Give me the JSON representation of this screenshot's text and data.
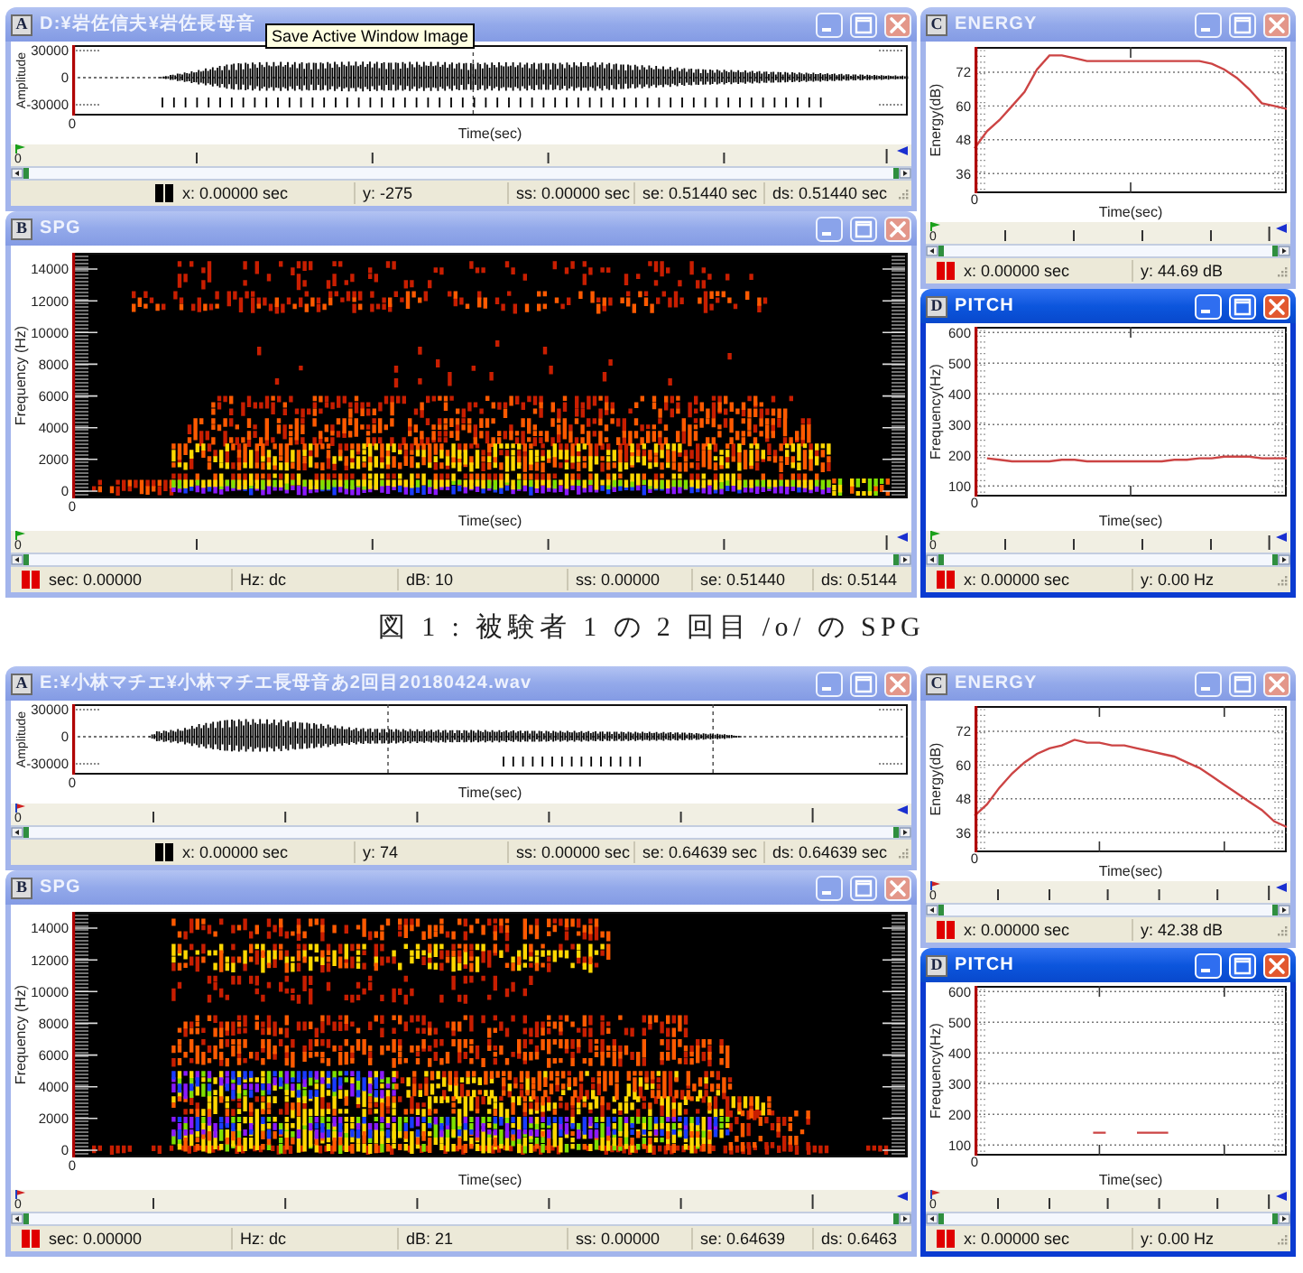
{
  "blocks": [
    {
      "kind": "screenshot",
      "windows": [
        {
          "kind": "waveform",
          "letter": "A",
          "title": "D:¥岩佐信夫¥岩佐長母音",
          "tooltip": "Save Active Window Image",
          "active": false,
          "y_label": "Amplitude",
          "y_ticks": [
            "30000",
            "0",
            "-30000"
          ],
          "x_tick": "0",
          "x_label": "Time(sec)",
          "marker_label": "0",
          "status": [
            "x: 0.00000 sec",
            "y: -275",
            "ss: 0.00000 sec",
            "se: 0.51440 sec",
            "ds: 0.51440 sec"
          ]
        },
        {
          "kind": "spectrogram",
          "letter": "B",
          "title": "SPG",
          "active": false,
          "y_label": "Frequency (Hz)",
          "y_ticks": [
            "14000",
            "12000",
            "10000",
            "8000",
            "6000",
            "4000",
            "2000",
            "0"
          ],
          "x_tick": "0",
          "x_label": "Time(sec)",
          "marker_label": "0",
          "status": [
            "sec: 0.00000",
            "Hz: dc",
            "dB: 10",
            "ss: 0.00000",
            "se: 0.51440",
            "ds: 0.5144"
          ]
        },
        {
          "kind": "energy",
          "letter": "C",
          "title": "ENERGY",
          "active": false,
          "chart_data": {
            "type": "line",
            "xlabel": "Time(sec)",
            "ylabel": "Energy(dB)",
            "series": [
              {
                "color": "#cc4444",
                "values": [
                  45,
                  51,
                  55,
                  60,
                  65,
                  73,
                  78,
                  78,
                  77,
                  76,
                  76,
                  76,
                  76,
                  76,
                  76,
                  76,
                  76,
                  76,
                  76,
                  75,
                  73,
                  70,
                  66,
                  61,
                  60,
                  59
                ]
              }
            ],
            "ylim": [
              29,
              81
            ],
            "yticks": [
              72,
              60,
              48,
              36
            ],
            "grid": true,
            "annotations": [
              "0"
            ]
          },
          "marker_label": "0",
          "status": [
            "x: 0.00000 sec",
            "y: 44.69 dB"
          ]
        },
        {
          "kind": "pitch",
          "letter": "D",
          "title": "PITCH",
          "active": true,
          "chart_data": {
            "type": "line",
            "xlabel": "Time(sec)",
            "ylabel": "Frequency(Hz)",
            "series": [
              {
                "color": "#cc4444",
                "values": [
                  null,
                  190,
                  185,
                  180,
                  180,
                  180,
                  180,
                  185,
                  185,
                  180,
                  180,
                  180,
                  180,
                  180,
                  180,
                  180,
                  185,
                  185,
                  190,
                  190,
                  195,
                  195,
                  195,
                  190,
                  190,
                  190
                ]
              }
            ],
            "ylim": [
              65,
              618
            ],
            "yticks": [
              600,
              500,
              400,
              300,
              200,
              100
            ],
            "grid": true,
            "annotations": [
              "0"
            ]
          },
          "marker_label": "0",
          "status": [
            "x: 0.00000 sec",
            "y: 0.00 Hz"
          ]
        }
      ]
    },
    {
      "kind": "caption",
      "text": "図 1 : 被験者 1 の 2 回目 /o/ の SPG"
    },
    {
      "kind": "screenshot",
      "windows": [
        {
          "kind": "waveform",
          "letter": "A",
          "title": "E:¥小林マチエ¥小林マチエ長母音あ2回目20180424.wav",
          "active": false,
          "y_label": "Amplitude",
          "y_ticks": [
            "30000",
            "0",
            "-30000"
          ],
          "x_tick": "0",
          "x_label": "Time(sec)",
          "marker_label": "0",
          "status": [
            "x: 0.00000 sec",
            "y: 74",
            "ss: 0.00000 sec",
            "se: 0.64639 sec",
            "ds: 0.64639 sec"
          ]
        },
        {
          "kind": "spectrogram",
          "letter": "B",
          "title": "SPG",
          "active": false,
          "y_label": "Frequency (Hz)",
          "y_ticks": [
            "14000",
            "12000",
            "10000",
            "8000",
            "6000",
            "4000",
            "2000",
            "0"
          ],
          "x_tick": "0",
          "x_label": "Time(sec)",
          "marker_label": "0",
          "status": [
            "sec: 0.00000",
            "Hz: dc",
            "dB: 21",
            "ss: 0.00000",
            "se: 0.64639",
            "ds: 0.6463"
          ]
        },
        {
          "kind": "energy",
          "letter": "C",
          "title": "ENERGY",
          "active": false,
          "chart_data": {
            "type": "line",
            "xlabel": "Time(sec)",
            "ylabel": "Energy(dB)",
            "series": [
              {
                "color": "#cc4444",
                "values": [
                  42,
                  46,
                  52,
                  57,
                  61,
                  64,
                  66,
                  67,
                  69,
                  68,
                  68,
                  67,
                  67,
                  66,
                  65,
                  64,
                  63,
                  61,
                  59,
                  56,
                  53,
                  50,
                  47,
                  44,
                  40,
                  38
                ]
              }
            ],
            "ylim": [
              29,
              81
            ],
            "yticks": [
              72,
              60,
              48,
              36
            ],
            "grid": true,
            "annotations": [
              "0"
            ]
          },
          "marker_label": "0",
          "status": [
            "x: 0.00000 sec",
            "y: 42.38 dB"
          ]
        },
        {
          "kind": "pitch",
          "letter": "D",
          "title": "PITCH",
          "active": true,
          "chart_data": {
            "type": "line",
            "xlabel": "Time(sec)",
            "ylabel": "Frequency(Hz)",
            "series": [
              {
                "color": "#cc4444",
                "values": [
                  null,
                  null,
                  null,
                  null,
                  null,
                  null,
                  null,
                  null,
                  null,
                  null,
                  null,
                  null,
                  null,
                  null,
                  null,
                  null,
                  null,
                  null,
                  null,
                  140,
                  140,
                  140,
                  null,
                  null,
                  null,
                  null,
                  140,
                  140,
                  140,
                  140,
                  140,
                  140,
                  null,
                  null,
                  null,
                  null,
                  null,
                  null,
                  null,
                  null,
                  null,
                  null,
                  null,
                  null,
                  null,
                  null,
                  null,
                  null,
                  null,
                  null,
                  null
                ]
              }
            ],
            "ylim": [
              65,
              618
            ],
            "yticks": [
              600,
              500,
              400,
              300,
              200,
              100
            ],
            "grid": true,
            "annotations": [
              "0"
            ]
          },
          "marker_label": "0",
          "status": [
            "x: 0.00000 sec",
            "y: 0.00 Hz"
          ]
        }
      ]
    }
  ]
}
